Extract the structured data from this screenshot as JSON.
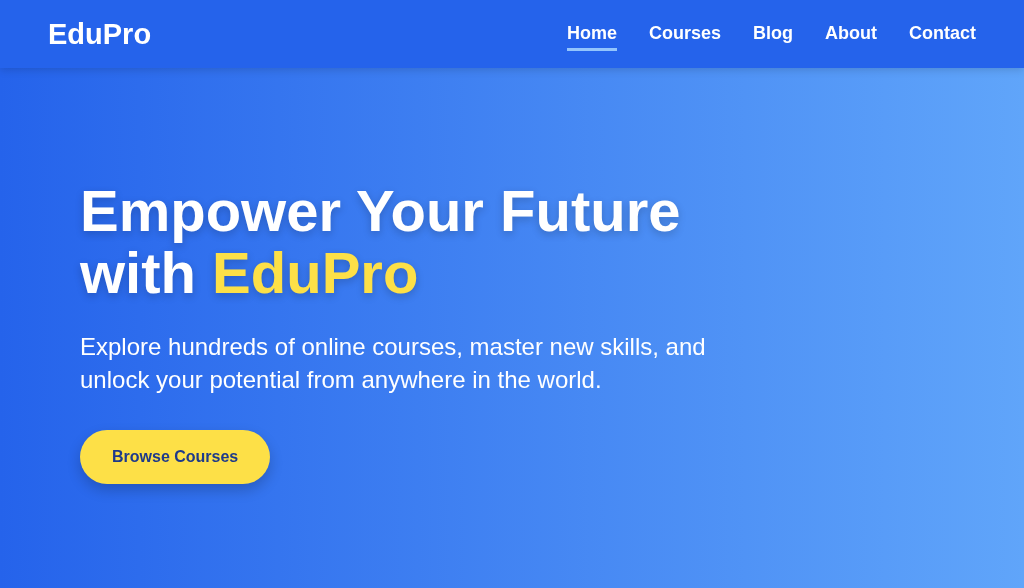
{
  "header": {
    "logo": "EduPro",
    "nav": [
      {
        "label": "Home",
        "selected": true
      },
      {
        "label": "Courses",
        "selected": false
      },
      {
        "label": "Blog",
        "selected": false
      },
      {
        "label": "About",
        "selected": false
      },
      {
        "label": "Contact",
        "selected": false
      }
    ]
  },
  "hero": {
    "heading": [
      {
        "text": "Empower Your Future with ",
        "highlight": false
      },
      {
        "text": "EduPro",
        "highlight": true
      }
    ],
    "subtitle": "Explore hundreds of online courses, master new skills, and unlock your potential from anywhere in the world.",
    "button": "Browse Courses"
  }
}
